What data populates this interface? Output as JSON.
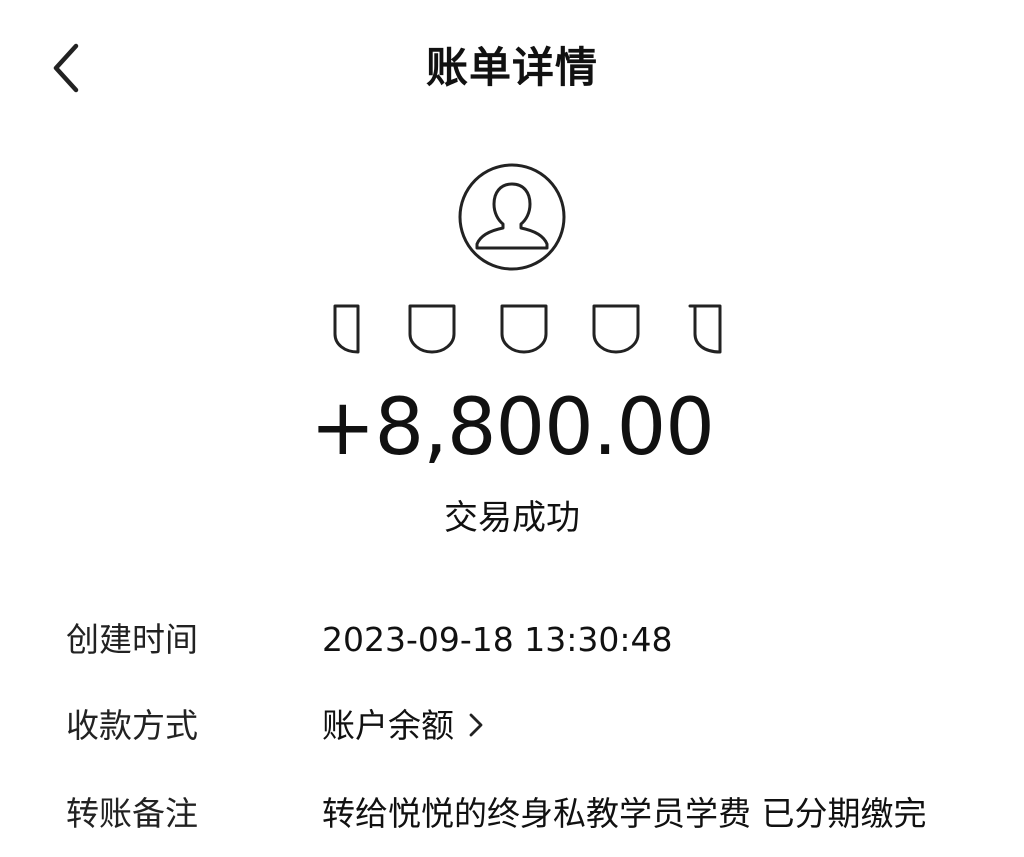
{
  "header": {
    "title": "账单详情"
  },
  "icons": {
    "back": "chevron-left-icon",
    "avatar": "default-user-avatar-icon",
    "pay_method_arrow": "chevron-right-icon",
    "masked_name": "masked-name-placeholder-glyphs"
  },
  "transaction": {
    "amount": "+8,800.00",
    "status": "交易成功"
  },
  "details": {
    "created_time": {
      "label": "创建时间",
      "value": "2023-09-18 13:30:48"
    },
    "payment_method": {
      "label": "收款方式",
      "value": "账户余额"
    },
    "transfer_note": {
      "label": "转账备注",
      "value": "转给悦悦的终身私教学员学费 已分期缴完"
    }
  },
  "colors": {
    "text": "#111111",
    "background": "#ffffff",
    "icon_stroke": "#222222"
  }
}
